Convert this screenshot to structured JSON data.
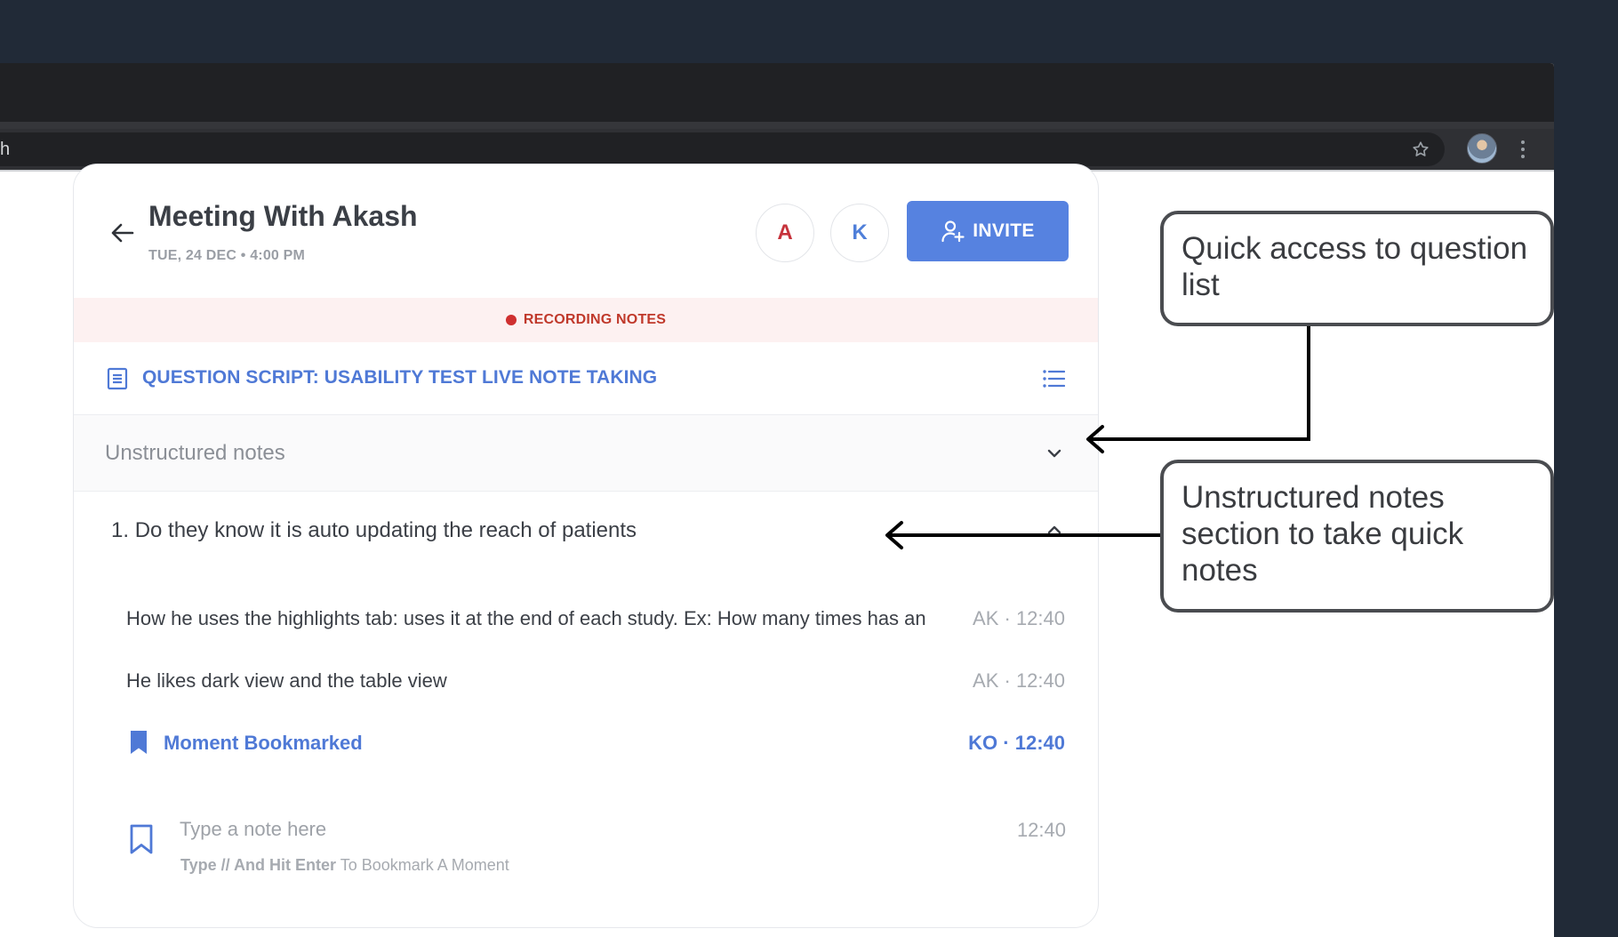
{
  "browser": {
    "address_text": "h"
  },
  "meeting": {
    "title": "Meeting With Akash",
    "date": "TUE, 24 DEC • 4:00 PM",
    "participants": [
      {
        "initial": "A",
        "color": "#c6323b"
      },
      {
        "initial": "K",
        "color": "#4f7fd9"
      }
    ],
    "invite_label": "INVITE"
  },
  "recording": {
    "label": "RECORDING NOTES",
    "color": "#c0392b"
  },
  "script": {
    "title": "QUESTION SCRIPT: USABILITY TEST LIVE NOTE TAKING"
  },
  "unstructured": {
    "label": "Unstructured notes"
  },
  "question": {
    "number": "1.",
    "text": "Do they know it is auto updating the reach of patients"
  },
  "notes": [
    {
      "text": "How he uses the highlights tab: uses it at the end of each study. Ex: How many times has an",
      "meta": "AK · 12:40"
    },
    {
      "text": "He likes dark view and the table view",
      "meta": "AK · 12:40"
    },
    {
      "text": "Moment Bookmarked",
      "meta": "KO · 12:40",
      "bookmark": true
    }
  ],
  "input": {
    "placeholder": "Type a note here",
    "time": "12:40",
    "hint_bold": "Type // And Hit Enter",
    "hint_rest": " To Bookmark A Moment"
  },
  "callouts": [
    {
      "text": "Quick access to question list"
    },
    {
      "text": "Unstructured notes section to take quick notes"
    }
  ],
  "colors": {
    "accent": "#5682e0",
    "link": "#4f79d6",
    "background": "#212a37"
  }
}
